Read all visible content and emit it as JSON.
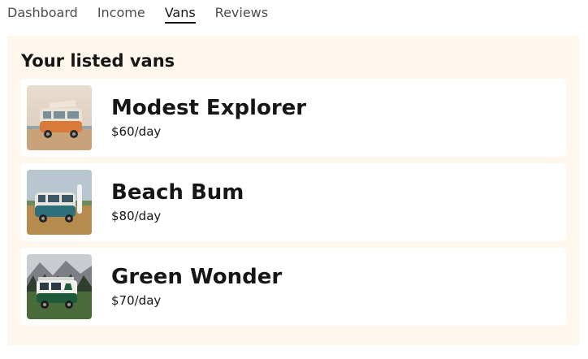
{
  "nav": {
    "items": [
      {
        "label": "Dashboard",
        "active": false
      },
      {
        "label": "Income",
        "active": false
      },
      {
        "label": "Vans",
        "active": true
      },
      {
        "label": "Reviews",
        "active": false
      }
    ]
  },
  "panel": {
    "title": "Your listed vans",
    "background_color": "#fff7ed"
  },
  "vans": [
    {
      "name": "Modest Explorer",
      "price": "$60/day",
      "image_icon": "orange-camper-van-photo"
    },
    {
      "name": "Beach Bum",
      "price": "$80/day",
      "image_icon": "teal-camper-van-photo"
    },
    {
      "name": "Green Wonder",
      "price": "$70/day",
      "image_icon": "green-camper-van-photo"
    }
  ]
}
